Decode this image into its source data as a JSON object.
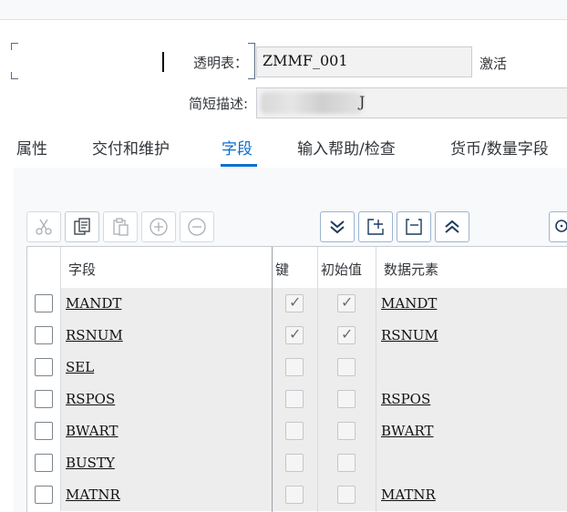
{
  "form": {
    "table_label": "透明表：",
    "table_value": "ZMMF_001",
    "status": "激活",
    "desc_label": "简短描述:",
    "desc_visible_tail": "J"
  },
  "tabs": [
    {
      "label": "属性",
      "active": false
    },
    {
      "label": "交付和维护",
      "active": false
    },
    {
      "label": "字段",
      "active": true
    },
    {
      "label": "输入帮助/检查",
      "active": false
    },
    {
      "label": "货币/数量字段",
      "active": false
    }
  ],
  "toolbar": {
    "buttons": [
      {
        "icon": "cut-icon",
        "enabled": false
      },
      {
        "icon": "copy-icon",
        "enabled": true
      },
      {
        "icon": "paste-icon",
        "enabled": false
      },
      {
        "icon": "insert-row-icon",
        "enabled": false
      },
      {
        "icon": "delete-row-icon",
        "enabled": false
      },
      {
        "icon": "expand-all-icon",
        "enabled": true
      },
      {
        "icon": "add-row-icon",
        "enabled": true
      },
      {
        "icon": "remove-row-icon",
        "enabled": true
      },
      {
        "icon": "collapse-all-icon",
        "enabled": true
      },
      {
        "icon": "search-icon",
        "enabled": true
      }
    ]
  },
  "table": {
    "headers": {
      "field": "字段",
      "key": "键",
      "initial": "初始值",
      "data_element": "数据元素"
    },
    "rows": [
      {
        "field": "MANDT",
        "key": true,
        "initial": true,
        "data_element": "MANDT"
      },
      {
        "field": "RSNUM",
        "key": true,
        "initial": true,
        "data_element": "RSNUM"
      },
      {
        "field": "SEL",
        "key": false,
        "initial": false,
        "data_element": ""
      },
      {
        "field": "RSPOS",
        "key": false,
        "initial": false,
        "data_element": "RSPOS"
      },
      {
        "field": "BWART",
        "key": false,
        "initial": false,
        "data_element": "BWART"
      },
      {
        "field": "BUSTY",
        "key": false,
        "initial": false,
        "data_element": ""
      },
      {
        "field": "MATNR",
        "key": false,
        "initial": false,
        "data_element": "MATNR"
      }
    ]
  },
  "colors": {
    "accent": "#0a6ed1",
    "row_bg": "#ededed",
    "panel_bg": "#f7f9fb"
  }
}
